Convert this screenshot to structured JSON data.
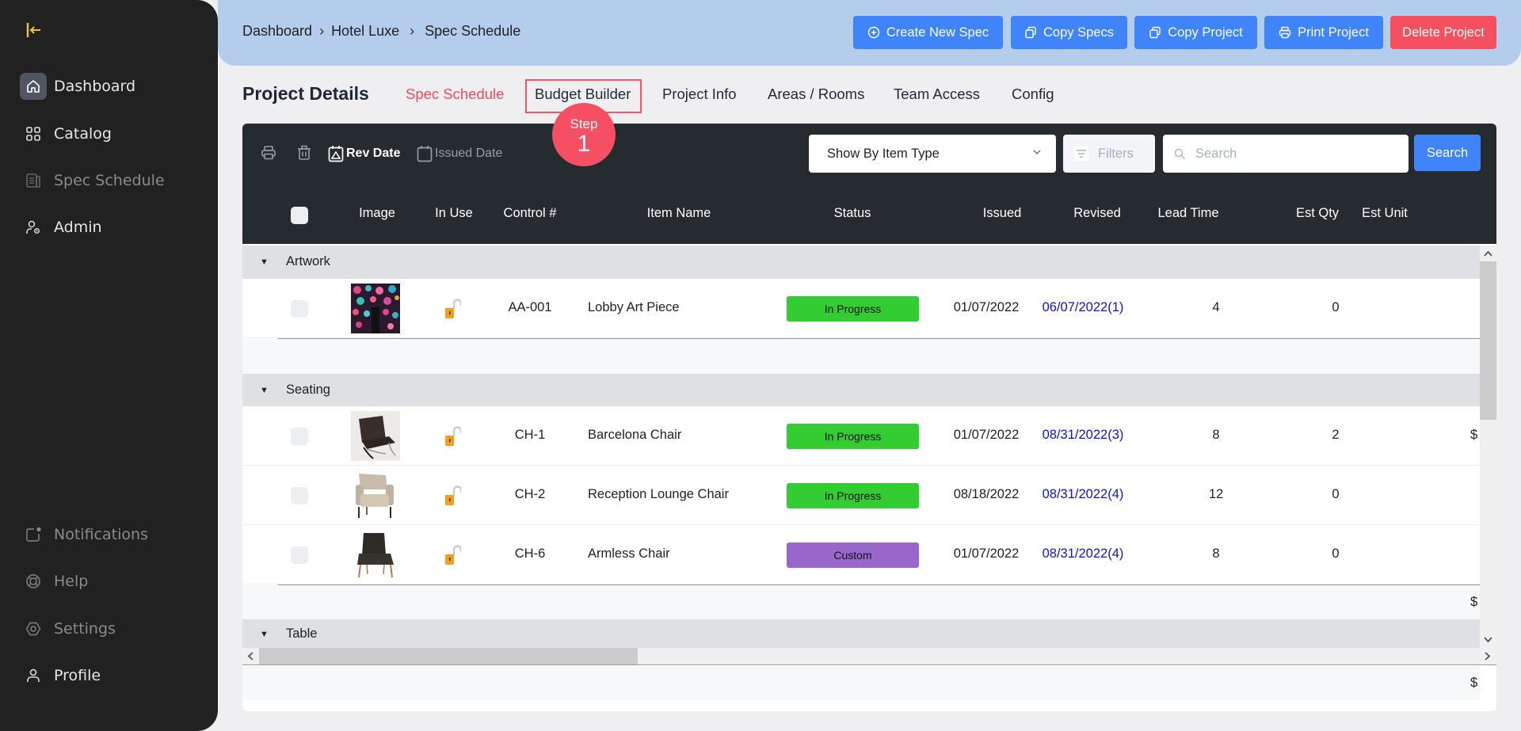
{
  "sidebar": {
    "collapse_icon": "collapse-left-icon",
    "top_items": [
      {
        "label": "Dashboard",
        "icon": "home-icon",
        "active": true
      },
      {
        "label": "Catalog",
        "icon": "grid-icon"
      },
      {
        "label": "Spec Schedule",
        "icon": "document-icon",
        "dim": true
      },
      {
        "label": "Admin",
        "icon": "user-gear-icon"
      }
    ],
    "bottom_items": [
      {
        "label": "Notifications",
        "icon": "notification-icon",
        "dim": true
      },
      {
        "label": "Help",
        "icon": "lifebuoy-icon",
        "dim": true
      },
      {
        "label": "Settings",
        "icon": "settings-icon",
        "dim": true
      },
      {
        "label": "Profile",
        "icon": "user-icon"
      }
    ]
  },
  "header": {
    "breadcrumb": [
      "Dashboard",
      "Hotel Luxe",
      "Spec Schedule"
    ],
    "breadcrumb_separator": "›",
    "buttons": [
      {
        "label": "Create New Spec",
        "icon": "plus-circle-icon"
      },
      {
        "label": "Copy Specs",
        "icon": "copy-icon"
      },
      {
        "label": "Copy Project",
        "icon": "copy-icon"
      },
      {
        "label": "Print Project",
        "icon": "printer-icon"
      },
      {
        "label": "Delete Project",
        "variant": "danger"
      }
    ]
  },
  "page": {
    "title": "Project Details",
    "tabs": [
      {
        "label": "Spec Schedule",
        "active": true
      },
      {
        "label": "Budget Builder",
        "highlighted": true
      },
      {
        "label": "Project Info"
      },
      {
        "label": "Areas / Rooms"
      },
      {
        "label": "Team Access"
      },
      {
        "label": "Config"
      }
    ],
    "step_badge": {
      "label": "Step",
      "number": "1"
    }
  },
  "toolbar": {
    "rev_date_label": "Rev Date",
    "issued_date_label": "Issued Date",
    "group_by_select": "Show By Item Type",
    "filters_label": "Filters",
    "search_placeholder": "Search",
    "search_value": "",
    "search_button": "Search"
  },
  "table": {
    "columns": [
      "Image",
      "In Use",
      "Control #",
      "Item Name",
      "Status",
      "Issued",
      "Revised",
      "Lead Time",
      "Est Qty",
      "Est Unit"
    ],
    "groups": [
      {
        "name": "Artwork",
        "rows": [
          {
            "image": "artwork-thumbnail",
            "control": "AA-001",
            "name": "Lobby Art Piece",
            "status": "In Progress",
            "issued": "01/07/2022",
            "revised": "06/07/2022(1)",
            "lead_time": "4",
            "est_qty": "0",
            "est_unit": ""
          }
        ],
        "subtotal": ""
      },
      {
        "name": "Seating",
        "rows": [
          {
            "image": "barcelona-chair-thumbnail",
            "control": "CH-1",
            "name": "Barcelona Chair",
            "status": "In Progress",
            "issued": "01/07/2022",
            "revised": "08/31/2022(3)",
            "lead_time": "8",
            "est_qty": "2",
            "est_unit": "$"
          },
          {
            "image": "lounge-chair-thumbnail",
            "control": "CH-2",
            "name": "Reception Lounge Chair",
            "status": "In Progress",
            "issued": "08/18/2022",
            "revised": "08/31/2022(4)",
            "lead_time": "12",
            "est_qty": "0",
            "est_unit": ""
          },
          {
            "image": "armless-chair-thumbnail",
            "control": "CH-6",
            "name": "Armless Chair",
            "status": "Custom",
            "issued": "01/07/2022",
            "revised": "08/31/2022(4)",
            "lead_time": "8",
            "est_qty": "0",
            "est_unit": ""
          }
        ],
        "subtotal": "$"
      },
      {
        "name": "Table",
        "rows": []
      }
    ],
    "footer_total": "$"
  },
  "colors": {
    "in_progress": "#33cc33",
    "custom": "#9966cc",
    "accent": "#3f84f8",
    "danger": "#f5505f",
    "link": "#1010e0"
  }
}
